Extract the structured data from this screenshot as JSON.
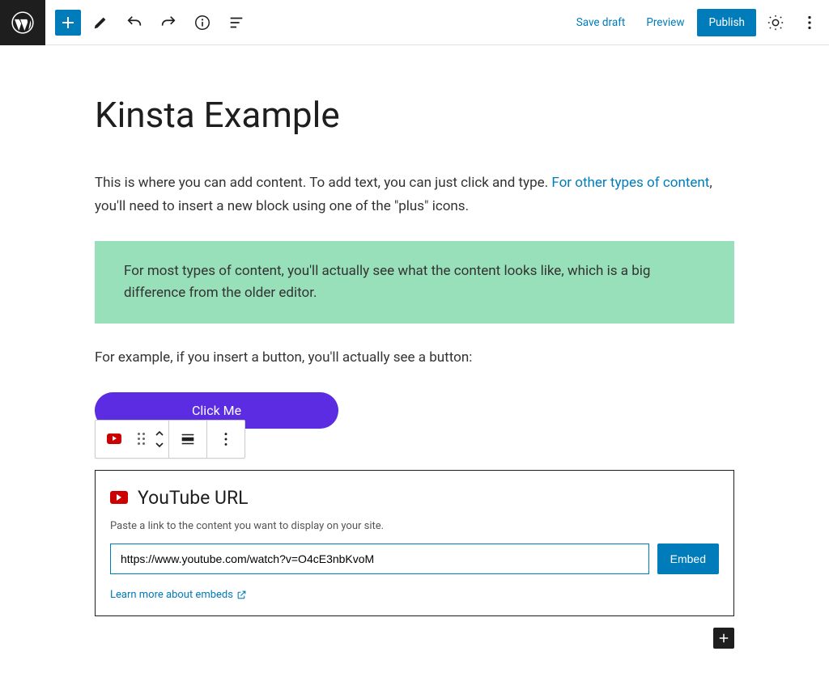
{
  "toolbar": {
    "save_draft": "Save draft",
    "preview": "Preview",
    "publish": "Publish"
  },
  "page": {
    "title": "Kinsta Example",
    "intro_part1": "This is where you can add content. To add text, you can just click and type. ",
    "intro_link": "For other types of content",
    "intro_part2": ", you'll need to insert a new block using one of the \"plus\" icons.",
    "callout": "For most types of content, you'll actually see what the content looks like, which is a big difference from the older editor.",
    "para2": "For example, if you insert a button, you'll actually see a button:",
    "button_label": "Click Me"
  },
  "embed": {
    "title": "YouTube URL",
    "desc": "Paste a link to the content you want to display on your site.",
    "value": "https://www.youtube.com/watch?v=O4cE3nbKvoM",
    "button": "Embed",
    "learn": "Learn more about embeds"
  }
}
